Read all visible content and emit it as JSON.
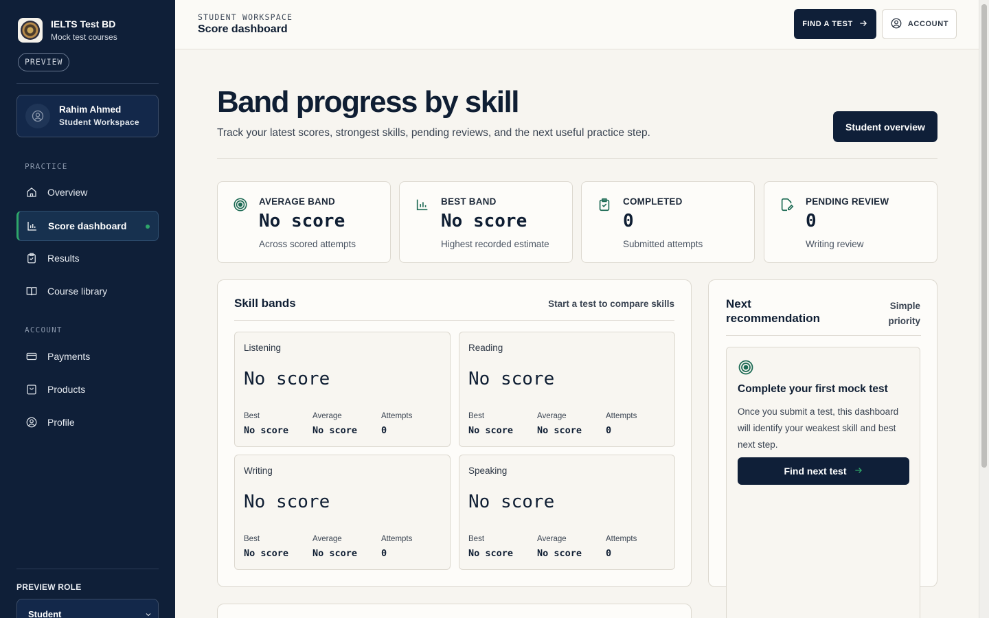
{
  "sidebar": {
    "brand_name": "IELTS Test BD",
    "brand_sub": "Mock test courses",
    "preview_badge": "PREVIEW",
    "user": {
      "name": "Rahim Ahmed",
      "role": "Student Workspace"
    },
    "practice_label": "PRACTICE",
    "practice_items": [
      {
        "label": "Overview",
        "icon": "home-icon"
      },
      {
        "label": "Score dashboard",
        "icon": "bar-chart-icon",
        "active": true
      },
      {
        "label": "Results",
        "icon": "clipboard-icon"
      },
      {
        "label": "Course library",
        "icon": "book-icon"
      }
    ],
    "account_label": "ACCOUNT",
    "account_items": [
      {
        "label": "Payments",
        "icon": "credit-card-icon"
      },
      {
        "label": "Products",
        "icon": "shopping-bag-icon"
      },
      {
        "label": "Profile",
        "icon": "user-circle-icon"
      }
    ],
    "preview_role_label": "PREVIEW ROLE",
    "preview_role_value": "Student"
  },
  "topbar": {
    "eyebrow": "STUDENT WORKSPACE",
    "title": "Score dashboard",
    "find_test_label": "FIND A TEST",
    "account_label": "ACCOUNT"
  },
  "hero": {
    "title": "Band progress by skill",
    "subtitle": "Track your latest scores, strongest skills, pending reviews, and the next useful practice step.",
    "overview_button": "Student overview"
  },
  "stats": [
    {
      "label": "AVERAGE BAND",
      "value": "No score",
      "note": "Across scored attempts",
      "icon": "target-icon"
    },
    {
      "label": "BEST BAND",
      "value": "No score",
      "note": "Highest recorded estimate",
      "icon": "bar-chart-icon"
    },
    {
      "label": "COMPLETED",
      "value": "0",
      "note": "Submitted attempts",
      "icon": "clipboard-check-icon"
    },
    {
      "label": "PENDING REVIEW",
      "value": "0",
      "note": "Writing review",
      "icon": "edit-file-icon"
    }
  ],
  "skill_panel": {
    "title": "Skill bands",
    "hint": "Start a test to compare skills",
    "metric_labels": {
      "best": "Best",
      "average": "Average",
      "attempts": "Attempts"
    },
    "skills": [
      {
        "name": "Listening",
        "value": "No score",
        "best": "No score",
        "average": "No score",
        "attempts": "0"
      },
      {
        "name": "Reading",
        "value": "No score",
        "best": "No score",
        "average": "No score",
        "attempts": "0"
      },
      {
        "name": "Writing",
        "value": "No score",
        "best": "No score",
        "average": "No score",
        "attempts": "0"
      },
      {
        "name": "Speaking",
        "value": "No score",
        "best": "No score",
        "average": "No score",
        "attempts": "0"
      }
    ]
  },
  "recommendation": {
    "title": "Next recommendation",
    "hint": "Simple priority",
    "card_title": "Complete your first mock test",
    "card_text": "Once you submit a test, this dashboard will identify your weakest skill and best next step.",
    "button": "Find next test"
  },
  "colors": {
    "navy": "#0f1f38",
    "accent_green": "#2ea66a",
    "icon_green": "#1e6b55",
    "background": "#f7f5f0"
  }
}
